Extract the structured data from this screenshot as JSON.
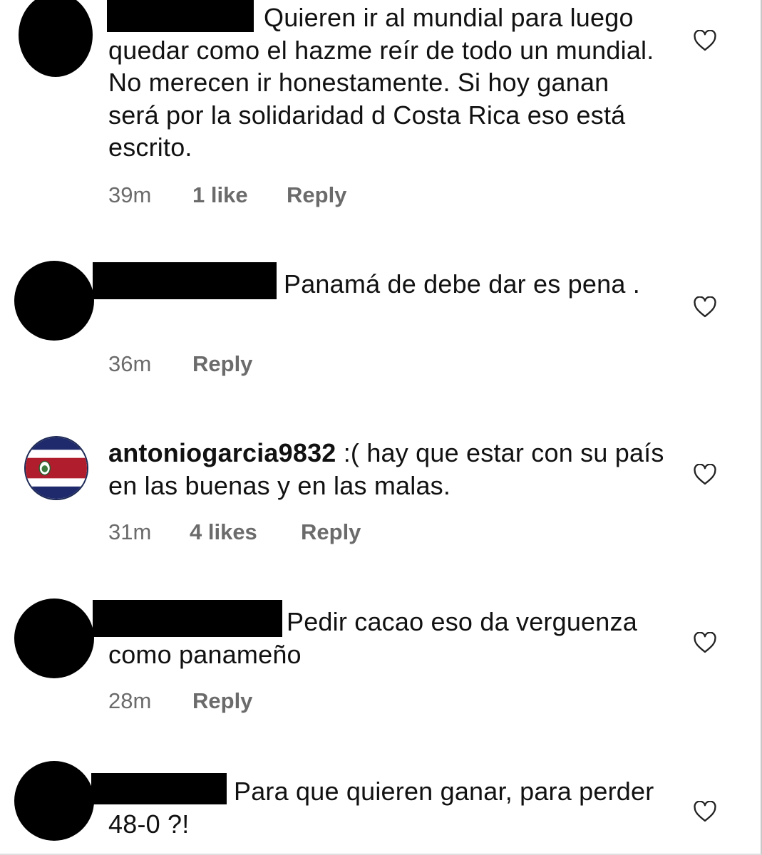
{
  "comments": [
    {
      "username": "",
      "text": "Quieren ir al mundial para luego quedar como el hazme reír de todo un mundial. No merecen ir honestamente. Si hoy ganan será por la solidaridad d Costa Rica eso está escrito.",
      "time": "39m",
      "likes": "1 like",
      "reply": "Reply"
    },
    {
      "username": "",
      "text": "Panamá de debe dar es pena .",
      "time": "36m",
      "likes": "",
      "reply": "Reply"
    },
    {
      "username": "antoniogarcia9832",
      "text": ":( hay que estar con su país en las buenas y en las malas.",
      "time": "31m",
      "likes": "4 likes",
      "reply": "Reply",
      "avatar_icon": "costa-rica-flag-icon"
    },
    {
      "username": "",
      "text": "Pedir cacao eso da verguenza  como panameño",
      "time": "28m",
      "likes": "",
      "reply": "Reply"
    },
    {
      "username": "",
      "text": "Para que quieren ganar, para perder 48-0 ?!",
      "time": "",
      "likes": "",
      "reply": ""
    }
  ],
  "colors": {
    "text": "#111111",
    "meta": "#6b6b6b",
    "flag_blue": "#1e2a6b",
    "flag_red": "#b01e2e",
    "redaction": "#000000"
  },
  "icons": {
    "like": "heart-outline-icon"
  }
}
